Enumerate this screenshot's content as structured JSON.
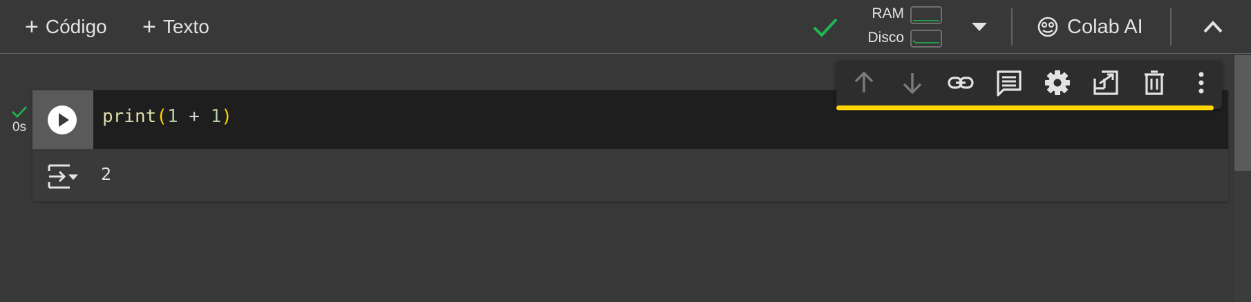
{
  "toolbar": {
    "add_code_label": "Código",
    "add_text_label": "Texto",
    "resources": {
      "ram_label": "RAM",
      "disk_label": "Disco"
    },
    "colab_ai_label": "Colab AI",
    "status_color": "#1db954"
  },
  "cell": {
    "code": {
      "fn": "print",
      "open": "(",
      "arg1": "1",
      "op": " + ",
      "arg2": "1",
      "close": ")"
    },
    "execution_time": "0s",
    "output": "2",
    "toolbar_icons": [
      "arrow-up-icon",
      "arrow-down-icon",
      "link-icon",
      "comment-icon",
      "gear-icon",
      "mirror-cell-icon",
      "trash-icon",
      "more-vert-icon"
    ],
    "highlight_color": "#ffd600"
  }
}
